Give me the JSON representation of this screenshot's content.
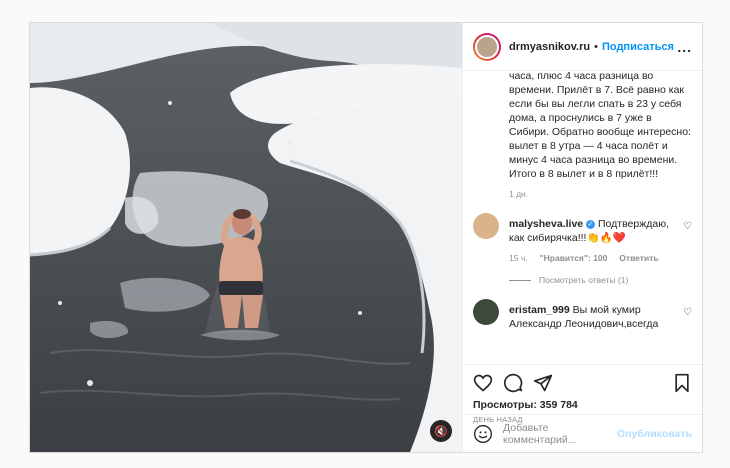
{
  "post": {
    "username": "drmyasnikov.ru",
    "separator": "•",
    "follow_label": "Подписаться",
    "more_label": "...",
    "caption": "часа, плюс 4 часа разница во времени. Прилёт в 7. Всё равно как если бы вы легли спать в 23 у себя дома, а проснулись в 7 уже в Сибири. Обратно вообще интересно: вылет в 8 утра — 4 часа полёт и минус 4 часа разница во времени. Итого в 8 вылет и в 8 прилёт!!!",
    "caption_time": "1 дн."
  },
  "comments": [
    {
      "user": "malysheva.live",
      "verified_mark": "✓",
      "text": "Подтверждаю, как сибирячка!!!👏🔥❤️",
      "time": "15 ч.",
      "likes": "\"Нравится\": 100",
      "reply": "Ответить",
      "view_replies": "Посмотреть ответы (1)",
      "avatar_color": "#d9b48a"
    },
    {
      "user": "eristam_999",
      "text": "Вы мой кумир Александр Леонидович,всегда",
      "avatar_color": "#3c4a3a"
    }
  ],
  "actions": {
    "views": "Просмотры: 359 784",
    "ago": "ДЕНЬ НАЗАД"
  },
  "add_comment": {
    "placeholder": "Добавьте комментарий...",
    "publish_label": "Опубликовать"
  },
  "icons": {
    "like": "heart-icon",
    "comment": "comment-icon",
    "share": "paper-plane-icon",
    "save": "bookmark-icon",
    "mute": "speaker-muted-icon",
    "emoji": "smile-icon"
  },
  "colors": {
    "accent": "#0095f6",
    "publish_disabled": "#b2dffc",
    "muted_text": "#8e8e8e"
  }
}
